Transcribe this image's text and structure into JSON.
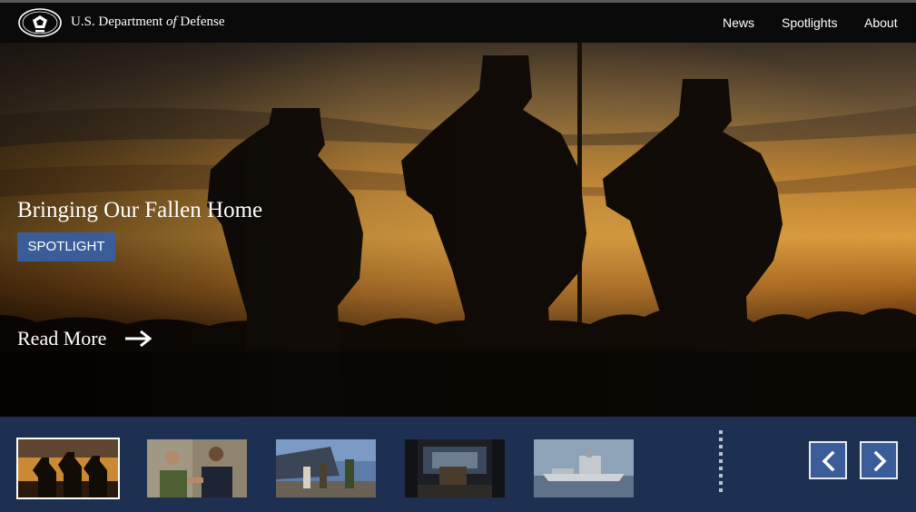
{
  "header": {
    "seal_icon": "dod-seal-icon",
    "brand_prefix": "U.S. Department",
    "brand_of": "of",
    "brand_suffix": "Defense",
    "nav": [
      "News",
      "Spotlights",
      "About"
    ]
  },
  "hero": {
    "title": "Bringing Our Fallen Home",
    "tag": "SPOTLIGHT",
    "read_more": "Read More",
    "arrow_icon": "arrow-right-icon"
  },
  "carousel": {
    "active_index": 0,
    "thumbnails": [
      {
        "name": "thumbnail-salute-silhouettes"
      },
      {
        "name": "thumbnail-handshake"
      },
      {
        "name": "thumbnail-pier-group"
      },
      {
        "name": "thumbnail-cargo-hold"
      },
      {
        "name": "thumbnail-ship"
      }
    ],
    "prev_icon": "chevron-left-icon",
    "next_icon": "chevron-right-icon"
  },
  "colors": {
    "header_bg": "#0a0a0a",
    "strip_bg": "#1d3051",
    "accent_blue": "#3a5d9a"
  }
}
